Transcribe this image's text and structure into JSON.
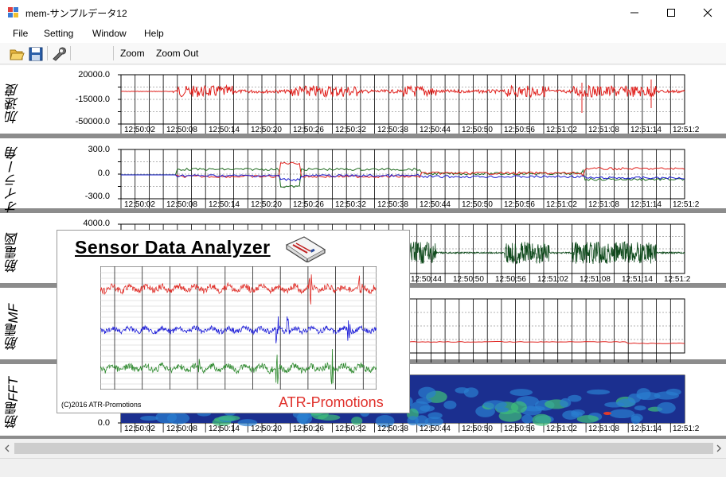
{
  "window": {
    "title": "mem-サンプルデータ12"
  },
  "menu": [
    "File",
    "Setting",
    "Window",
    "Help"
  ],
  "toolbar": {
    "zoom_label": "Zoom",
    "zoom_out_label": "Zoom Out"
  },
  "panels": [
    {
      "label": "加速度",
      "y_ticks": [
        "20000.0",
        "-15000.0",
        "-50000.0"
      ]
    },
    {
      "label": "オイラー角",
      "y_ticks": [
        "300.0",
        "0.0",
        "-300.0"
      ]
    },
    {
      "label": "筋電図",
      "y_ticks": [
        "4000.0"
      ]
    },
    {
      "label": "筋電MF",
      "y_ticks": []
    },
    {
      "label": "筋電FFT",
      "y_ticks": [
        "0.0"
      ]
    }
  ],
  "time_labels": [
    "12:50:02",
    "12:50:08",
    "12:50:14",
    "12:50:20",
    "12:50:26",
    "12:50:32",
    "12:50:38",
    "12:50:44",
    "12:50:50",
    "12:50:56",
    "12:51:02",
    "12:51:08",
    "12:51:14",
    "12:51:2"
  ],
  "emg_time_labels": [
    "12:50:44",
    "12:50:50",
    "12:50:56",
    "12:51:02",
    "12:51:08",
    "12:51:14",
    "12:51:2"
  ],
  "splash": {
    "title": "Sensor Data Analyzer",
    "copyright": "(C)2016 ATR-Promotions",
    "brand": "ATR-Promotions"
  },
  "colors": {
    "red": "#e0201c",
    "green": "#1f6b1f",
    "blue": "#1a1acf",
    "emg": "#0f4a1c"
  }
}
